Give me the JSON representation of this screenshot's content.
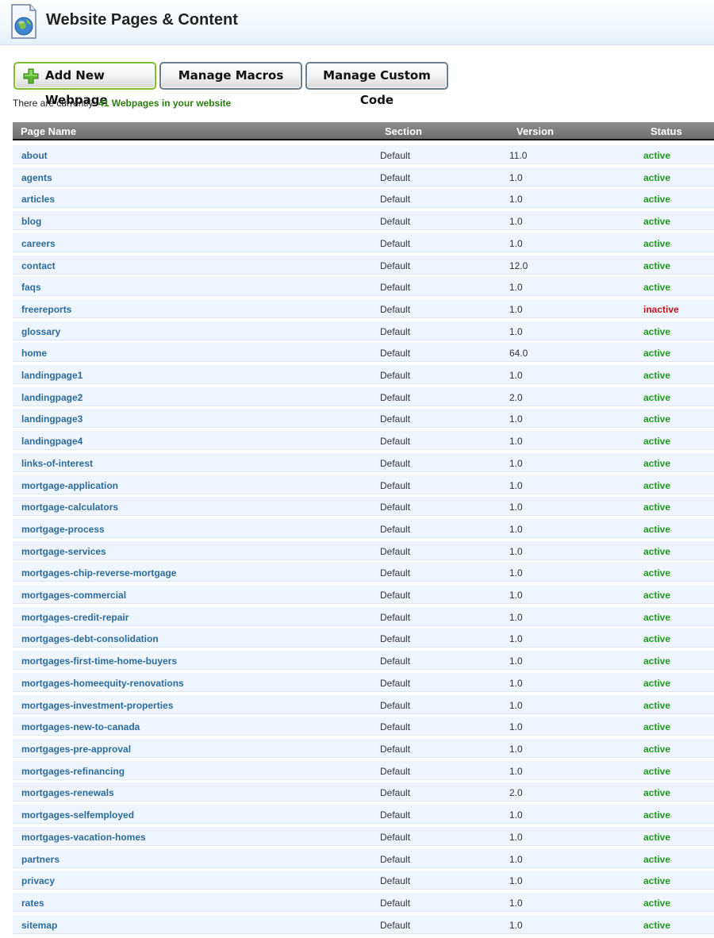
{
  "header": {
    "title": "Website Pages & Content",
    "icon": "globe-page-icon"
  },
  "toolbar": {
    "add_label": "Add New Webpage",
    "macros_label": "Manage Macros",
    "custom_code_label": "Manage Custom Code"
  },
  "summary": {
    "prefix": "There are currently:",
    "count_text": "41 Webpages in your website"
  },
  "table": {
    "headers": {
      "name": "Page Name",
      "section": "Section",
      "version": "Version",
      "status": "Status"
    },
    "rows": [
      {
        "name": "about",
        "section": "Default",
        "version": "11.0",
        "status": "active"
      },
      {
        "name": "agents",
        "section": "Default",
        "version": "1.0",
        "status": "active"
      },
      {
        "name": "articles",
        "section": "Default",
        "version": "1.0",
        "status": "active"
      },
      {
        "name": "blog",
        "section": "Default",
        "version": "1.0",
        "status": "active"
      },
      {
        "name": "careers",
        "section": "Default",
        "version": "1.0",
        "status": "active"
      },
      {
        "name": "contact",
        "section": "Default",
        "version": "12.0",
        "status": "active"
      },
      {
        "name": "faqs",
        "section": "Default",
        "version": "1.0",
        "status": "active"
      },
      {
        "name": "freereports",
        "section": "Default",
        "version": "1.0",
        "status": "inactive"
      },
      {
        "name": "glossary",
        "section": "Default",
        "version": "1.0",
        "status": "active"
      },
      {
        "name": "home",
        "section": "Default",
        "version": "64.0",
        "status": "active"
      },
      {
        "name": "landingpage1",
        "section": "Default",
        "version": "1.0",
        "status": "active"
      },
      {
        "name": "landingpage2",
        "section": "Default",
        "version": "2.0",
        "status": "active"
      },
      {
        "name": "landingpage3",
        "section": "Default",
        "version": "1.0",
        "status": "active"
      },
      {
        "name": "landingpage4",
        "section": "Default",
        "version": "1.0",
        "status": "active"
      },
      {
        "name": "links-of-interest",
        "section": "Default",
        "version": "1.0",
        "status": "active"
      },
      {
        "name": "mortgage-application",
        "section": "Default",
        "version": "1.0",
        "status": "active"
      },
      {
        "name": "mortgage-calculators",
        "section": "Default",
        "version": "1.0",
        "status": "active"
      },
      {
        "name": "mortgage-process",
        "section": "Default",
        "version": "1.0",
        "status": "active"
      },
      {
        "name": "mortgage-services",
        "section": "Default",
        "version": "1.0",
        "status": "active"
      },
      {
        "name": "mortgages-chip-reverse-mortgage",
        "section": "Default",
        "version": "1.0",
        "status": "active"
      },
      {
        "name": "mortgages-commercial",
        "section": "Default",
        "version": "1.0",
        "status": "active"
      },
      {
        "name": "mortgages-credit-repair",
        "section": "Default",
        "version": "1.0",
        "status": "active"
      },
      {
        "name": "mortgages-debt-consolidation",
        "section": "Default",
        "version": "1.0",
        "status": "active"
      },
      {
        "name": "mortgages-first-time-home-buyers",
        "section": "Default",
        "version": "1.0",
        "status": "active"
      },
      {
        "name": "mortgages-homeequity-renovations",
        "section": "Default",
        "version": "1.0",
        "status": "active"
      },
      {
        "name": "mortgages-investment-properties",
        "section": "Default",
        "version": "1.0",
        "status": "active"
      },
      {
        "name": "mortgages-new-to-canada",
        "section": "Default",
        "version": "1.0",
        "status": "active"
      },
      {
        "name": "mortgages-pre-approval",
        "section": "Default",
        "version": "1.0",
        "status": "active"
      },
      {
        "name": "mortgages-refinancing",
        "section": "Default",
        "version": "1.0",
        "status": "active"
      },
      {
        "name": "mortgages-renewals",
        "section": "Default",
        "version": "2.0",
        "status": "active"
      },
      {
        "name": "mortgages-selfemployed",
        "section": "Default",
        "version": "1.0",
        "status": "active"
      },
      {
        "name": "mortgages-vacation-homes",
        "section": "Default",
        "version": "1.0",
        "status": "active"
      },
      {
        "name": "partners",
        "section": "Default",
        "version": "1.0",
        "status": "active"
      },
      {
        "name": "privacy",
        "section": "Default",
        "version": "1.0",
        "status": "active"
      },
      {
        "name": "rates",
        "section": "Default",
        "version": "1.0",
        "status": "active"
      },
      {
        "name": "sitemap",
        "section": "Default",
        "version": "1.0",
        "status": "active"
      }
    ]
  },
  "colors": {
    "link": "#2c6b9c",
    "active": "#1f9a1f",
    "inactive": "#c01818",
    "count_text": "#2b7d0f",
    "add_button_border": "#7fbf2e"
  }
}
